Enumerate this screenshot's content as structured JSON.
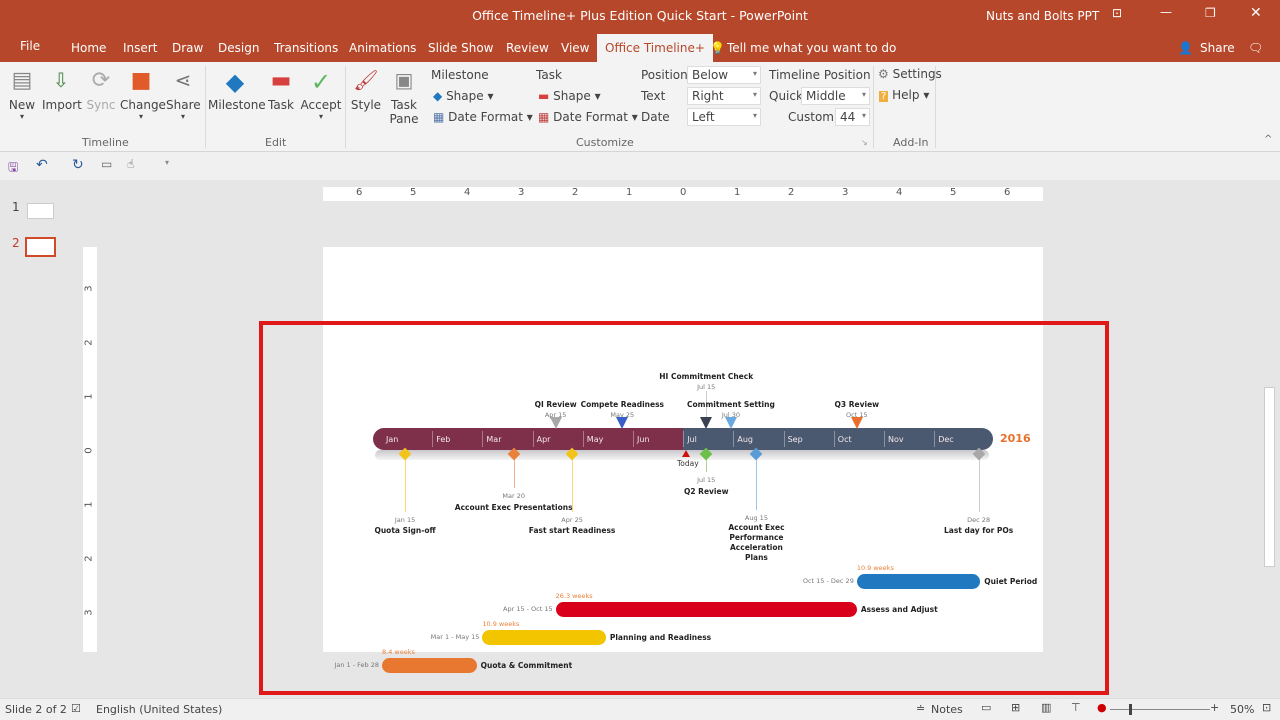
{
  "window": {
    "title": "Office Timeline+ Plus Edition Quick Start - PowerPoint",
    "user": "Nuts and Bolts PPT"
  },
  "tabs": [
    "File",
    "Home",
    "Insert",
    "Draw",
    "Design",
    "Transitions",
    "Animations",
    "Slide Show",
    "Review",
    "View",
    "Office Timeline+"
  ],
  "tell_me": "Tell me what you want to do",
  "share": "Share",
  "ribbon": {
    "timeline": {
      "new": "New",
      "import": "Import",
      "sync": "Sync",
      "change": "Change",
      "share": "Share",
      "group": "Timeline"
    },
    "edit": {
      "milestone": "Milestone",
      "task": "Task",
      "accept": "Accept",
      "group": "Edit"
    },
    "customize": {
      "style": "Style",
      "task_pane": "Task Pane",
      "milestone": "Milestone",
      "task": "Task",
      "shape": "Shape",
      "date_format": "Date Format",
      "position_label": "Position",
      "position": "Below",
      "text_label": "Text",
      "text": "Right",
      "date_label": "Date",
      "date": "Left",
      "timeline_position": "Timeline Position",
      "quick_label": "Quick",
      "quick": "Middle",
      "custom_label": "Custom",
      "custom": "44",
      "group": "Customize"
    },
    "addin": {
      "settings": "Settings",
      "help": "Help",
      "group": "Add-In"
    }
  },
  "thumbnails": [
    "1",
    "2"
  ],
  "ruler_h": [
    "6",
    "5",
    "4",
    "3",
    "2",
    "1",
    "0",
    "1",
    "2",
    "3",
    "4",
    "5",
    "6"
  ],
  "ruler_v": [
    "3",
    "2",
    "1",
    "0",
    "1",
    "2",
    "3"
  ],
  "timeline": {
    "year": "2016",
    "months": [
      "Jan",
      "Feb",
      "Mar",
      "Apr",
      "May",
      "Jun",
      "Jul",
      "Aug",
      "Sep",
      "Oct",
      "Nov",
      "Dec"
    ],
    "today": "Today",
    "milestones_above": [
      {
        "title": "HI Commitment Check",
        "date": "Jul 15",
        "color": "#3a4150"
      },
      {
        "title": "QI Review",
        "date": "Apr 15",
        "color": "#a8a8a8"
      },
      {
        "title": "Compete Readiness",
        "date": "May 25",
        "color": "#3a5fc8"
      },
      {
        "title": "Commitment Setting",
        "date": "Jul 30",
        "color": "#6aa8e0"
      },
      {
        "title": "Q3 Review",
        "date": "Oct 15",
        "color": "#e8702a"
      }
    ],
    "milestones_below": [
      {
        "title": "Quota Sign-off",
        "date": "Jan 15",
        "color": "#f2c318"
      },
      {
        "title": "Account Exec Presentations",
        "date": "Mar 20",
        "color": "#e8823a"
      },
      {
        "title": "Fast start Readiness",
        "date": "Apr 25",
        "color": "#f2c318"
      },
      {
        "title": "Q2 Review",
        "date": "Jul 15",
        "color": "#6cc04a"
      },
      {
        "title": "Account Exec Performance Acceleration Plans",
        "date": "Aug 15",
        "color": "#5b9bd5"
      },
      {
        "title": "Last day for POs",
        "date": "Dec 28",
        "color": "#a8a8a8"
      }
    ],
    "tasks": [
      {
        "name": "Quiet Period",
        "dates": "Oct 15 - Dec 29",
        "duration": "10.9 weeks",
        "color": "#1f78c0"
      },
      {
        "name": "Assess and Adjust",
        "dates": "Apr 15 - Oct 15",
        "duration": "26.3 weeks",
        "color": "#d9001b"
      },
      {
        "name": "Planning and Readiness",
        "dates": "Mar 1 - May 15",
        "duration": "10.9 weeks",
        "color": "#f2c500"
      },
      {
        "name": "Quota & Commitment",
        "dates": "Jan 1 - Feb 28",
        "duration": "8.4 weeks",
        "color": "#e8782f"
      }
    ]
  },
  "status": {
    "slide": "Slide 2 of 2",
    "language": "English (United States)",
    "notes": "Notes",
    "zoom": "50%"
  }
}
